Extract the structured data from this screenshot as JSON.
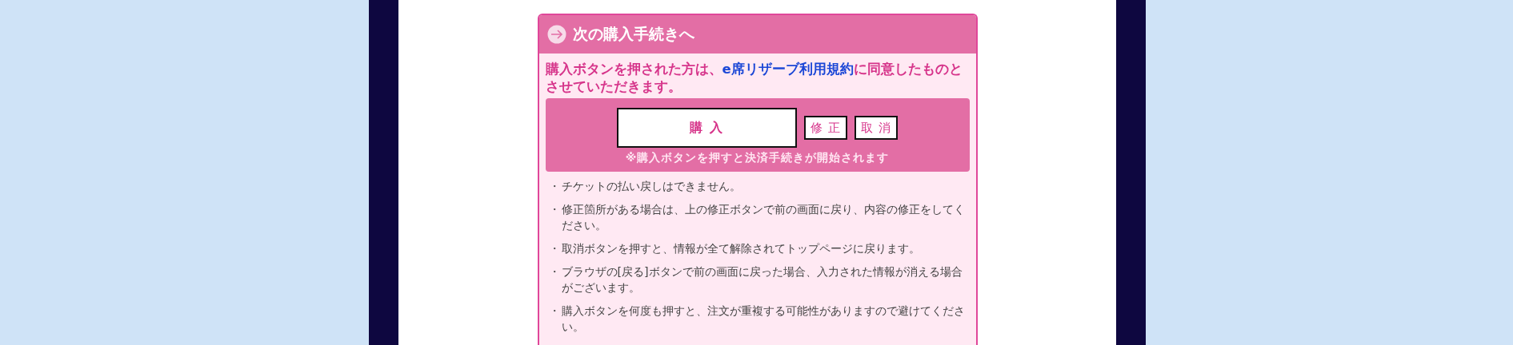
{
  "panel": {
    "title": "次の購入手続きへ",
    "agreement": [
      {
        "text": "購入ボタンを押された方は、",
        "kind": "plain"
      },
      {
        "text": "e席リザーブ利用規約",
        "kind": "link"
      },
      {
        "text": "に同意したものとさせていただきます。",
        "kind": "plain"
      }
    ],
    "buttons": [
      {
        "label": "購 入",
        "kind": "primary"
      },
      {
        "label": "修 正",
        "kind": "secondary"
      },
      {
        "label": "取 消",
        "kind": "secondary"
      }
    ],
    "button_note": "※購入ボタンを押すと決済手続きが開始されます",
    "notes": [
      {
        "bullet": "・",
        "text": "チケットの払い戻しはできません。"
      },
      {
        "bullet": "・",
        "text": "修正箇所がある場合は、上の修正ボタンで前の画面に戻り、内容の修正をしてください。"
      },
      {
        "bullet": "・",
        "text": "取消ボタンを押すと、情報が全て解除されてトップページに戻ります。"
      },
      {
        "bullet": "・",
        "text": "ブラウザの[戻る]ボタンで前の画面に戻った場合、入力された情報が消える場合がございます。"
      },
      {
        "bullet": "・",
        "text": "購入ボタンを何度も押すと、注文が重複する可能性がありますので避けてください。"
      }
    ]
  }
}
